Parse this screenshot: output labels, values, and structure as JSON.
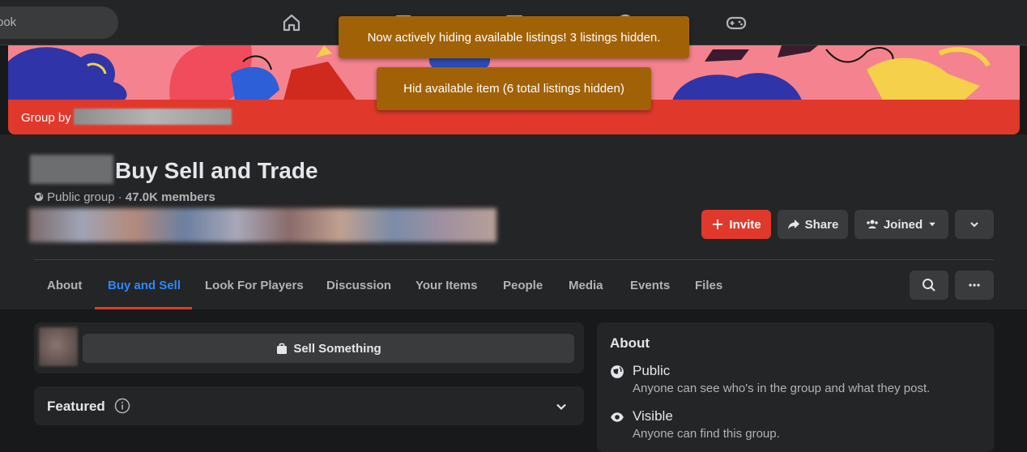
{
  "topbar": {
    "search_text": "ook"
  },
  "cover": {
    "group_by_label": "Group by"
  },
  "group": {
    "title": "Buy Sell and Trade",
    "privacy": "Public group",
    "separator": "·",
    "members": "47.0K members"
  },
  "actions": {
    "invite": "Invite",
    "share": "Share",
    "joined": "Joined"
  },
  "tabs": [
    {
      "label": "About"
    },
    {
      "label": "Buy and Sell"
    },
    {
      "label": "Look For Players"
    },
    {
      "label": "Discussion"
    },
    {
      "label": "Your Items"
    },
    {
      "label": "People"
    },
    {
      "label": "Media"
    },
    {
      "label": "Events"
    },
    {
      "label": "Files"
    }
  ],
  "sell": {
    "label": "Sell Something"
  },
  "featured": {
    "label": "Featured"
  },
  "about": {
    "heading": "About",
    "public_title": "Public",
    "public_desc": "Anyone can see who's in the group and what they post.",
    "visible_title": "Visible",
    "visible_desc": "Anyone can find this group."
  },
  "toasts": {
    "first": "Now actively hiding available listings! 3 listings hidden.",
    "second": "Hid available item (6 total listings hidden)"
  },
  "colors": {
    "accent": "#2d88ff",
    "invite": "#e0392b",
    "toast": "#a16207"
  }
}
